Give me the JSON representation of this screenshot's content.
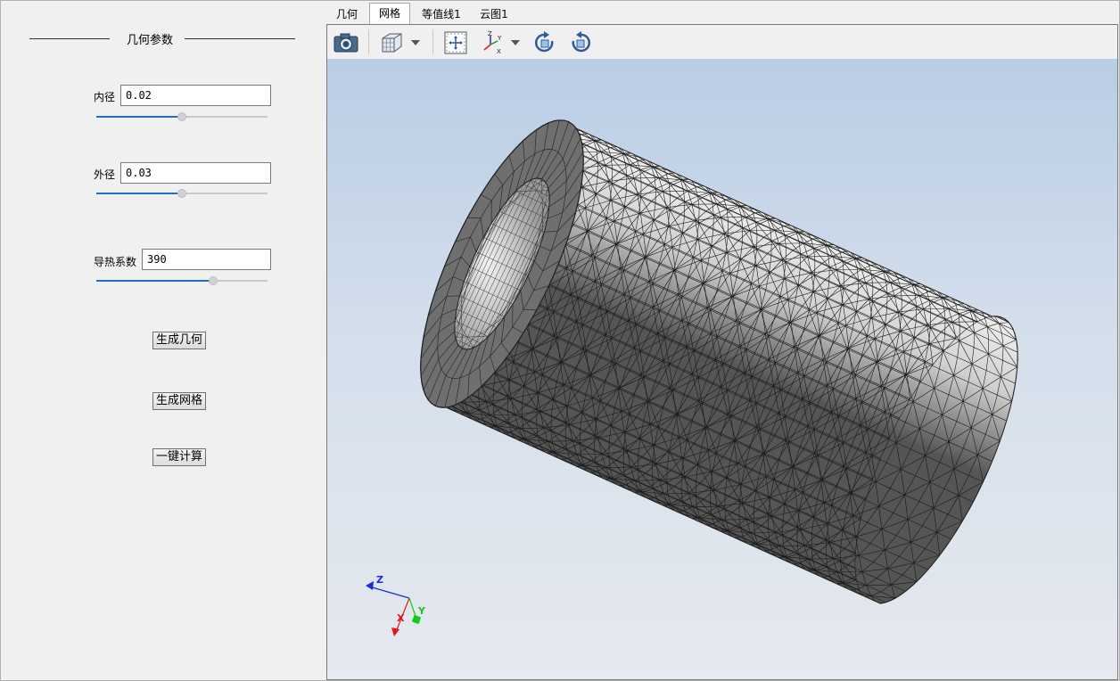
{
  "left_panel": {
    "section_title": "几何参数",
    "params": [
      {
        "label": "内径",
        "value": "0.02",
        "slider_fraction": 0.5
      },
      {
        "label": "外径",
        "value": "0.03",
        "slider_fraction": 0.5
      },
      {
        "label": "导热系数",
        "value": "390",
        "slider_fraction": 0.68
      }
    ],
    "buttons": {
      "generate_geometry": "生成几何",
      "generate_mesh": "生成网格",
      "compute_all": "一键计算"
    }
  },
  "tabs": [
    {
      "label": "几何",
      "active": false
    },
    {
      "label": "网格",
      "active": true
    },
    {
      "label": "等值线1",
      "active": false
    },
    {
      "label": "云图1",
      "active": false
    }
  ],
  "toolbar": {
    "icons": [
      "camera-icon",
      "view-cube-icon",
      "dropdown-arrow-icon",
      "fit-view-icon",
      "axes-icon",
      "dropdown-arrow-icon",
      "rotate-cw-icon",
      "rotate-ccw-icon"
    ]
  },
  "viewport": {
    "triad_labels": {
      "x": "X",
      "y": "Y",
      "z": "Z"
    },
    "colors": {
      "x_axis": "#e8141b",
      "y_axis": "#14c814",
      "z_axis": "#1a2bd6"
    }
  }
}
